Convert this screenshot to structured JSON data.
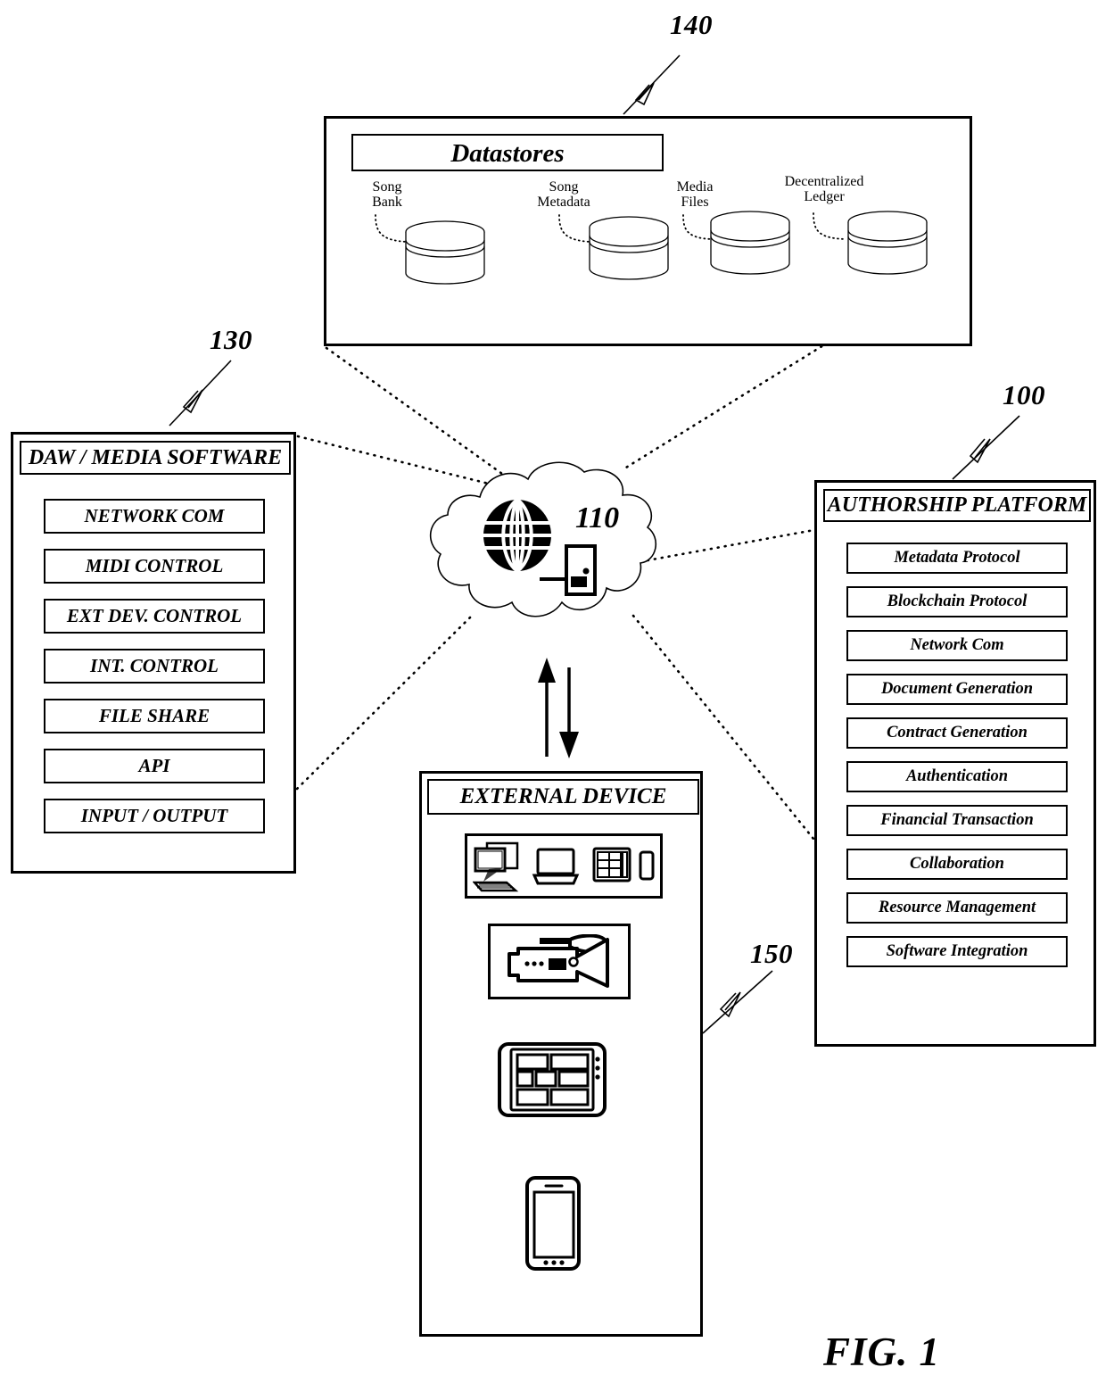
{
  "figure": {
    "caption": "FIG. 1",
    "reference_numerals": [
      {
        "id": "140",
        "label": "140",
        "target": "Datastores"
      },
      {
        "id": "130",
        "label": "130",
        "target": "DAW / Media Software"
      },
      {
        "id": "100",
        "label": "100",
        "target": "Authorship Platform"
      },
      {
        "id": "110",
        "label": "110",
        "target": "Network / Cloud"
      },
      {
        "id": "150",
        "label": "150",
        "target": "External Device"
      }
    ]
  },
  "datastores": {
    "title": "Datastores",
    "items": [
      {
        "label": "Song\nBank"
      },
      {
        "label": "Song\nMetadata"
      },
      {
        "label": "Media\nFiles"
      },
      {
        "label": "Decentralized\nLedger"
      }
    ]
  },
  "daw": {
    "title": "DAW / MEDIA SOFTWARE",
    "modules": [
      {
        "label": "NETWORK COM"
      },
      {
        "label": "MIDI CONTROL"
      },
      {
        "label": "EXT DEV. CONTROL"
      },
      {
        "label": "INT. CONTROL"
      },
      {
        "label": "FILE SHARE"
      },
      {
        "label": "API"
      },
      {
        "label": "INPUT / OUTPUT"
      }
    ]
  },
  "platform": {
    "title": "AUTHORSHIP PLATFORM",
    "modules": [
      {
        "label": "Metadata Protocol"
      },
      {
        "label": "Blockchain Protocol"
      },
      {
        "label": "Network Com"
      },
      {
        "label": "Document Generation"
      },
      {
        "label": "Contract Generation"
      },
      {
        "label": "Authentication"
      },
      {
        "label": "Financial Transaction"
      },
      {
        "label": "Collaboration"
      },
      {
        "label": "Resource Management"
      },
      {
        "label": "Software Integration"
      }
    ]
  },
  "external_device": {
    "title": "EXTERNAL DEVICE",
    "device_icons": [
      {
        "name": "desktop-computer-icon"
      },
      {
        "name": "laptop-icon"
      },
      {
        "name": "tablet-keyboard-icon"
      },
      {
        "name": "remote-control-icon"
      },
      {
        "name": "video-camera-icon"
      },
      {
        "name": "tablet-icon"
      },
      {
        "name": "smartphone-icon"
      }
    ]
  },
  "network": {
    "numeral": "110",
    "icons": [
      {
        "name": "globe-icon"
      },
      {
        "name": "server-icon"
      }
    ]
  },
  "colors": {
    "stroke": "#000000",
    "background": "#ffffff"
  }
}
